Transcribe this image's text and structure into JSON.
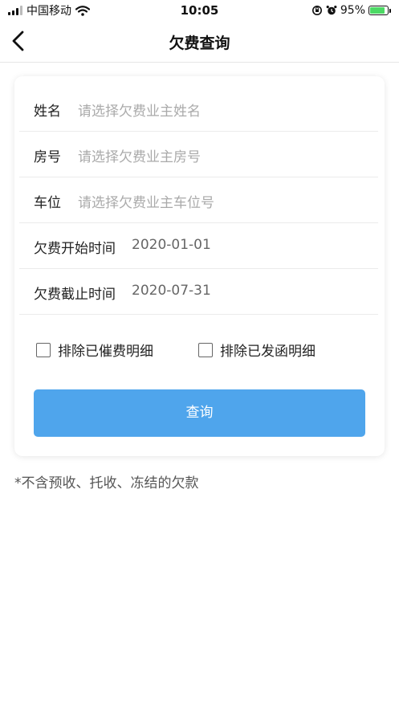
{
  "status_bar": {
    "carrier": "中国移动",
    "time": "10:05",
    "battery_percent": "95%",
    "battery_level": 0.95,
    "icons": [
      "signal-icon",
      "wifi-icon",
      "orientation-lock-icon",
      "alarm-icon",
      "battery-charging-icon"
    ]
  },
  "nav": {
    "title": "欠费查询",
    "back_icon": "chevron-left-icon"
  },
  "form": {
    "fields": [
      {
        "label": "姓名",
        "placeholder": "请选择欠费业主姓名"
      },
      {
        "label": "房号",
        "placeholder": "请选择欠费业主房号"
      },
      {
        "label": "车位",
        "placeholder": "请选择欠费业主车位号"
      },
      {
        "label": "欠费开始时间",
        "value": "2020-01-01"
      },
      {
        "label": "欠费截止时间",
        "value": "2020-07-31"
      }
    ],
    "checkboxes": [
      {
        "label": "排除已催费明细",
        "checked": false
      },
      {
        "label": "排除已发函明细",
        "checked": false
      }
    ],
    "submit_label": "查询"
  },
  "footnote": "*不含预收、托收、冻结的欠款",
  "colors": {
    "accent": "#4fa5ec",
    "battery_fill": "#4cd964",
    "placeholder": "#aaaaaa"
  }
}
